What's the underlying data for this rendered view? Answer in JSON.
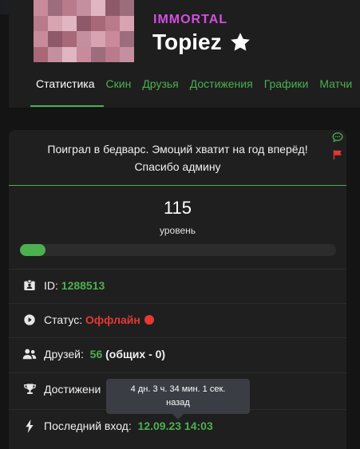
{
  "profile": {
    "rank": "IMMORTAL",
    "nickname": "Topiez",
    "rank_color": "#d34fe0"
  },
  "tabs": [
    {
      "label": "Статистика",
      "active": true
    },
    {
      "label": "Скин"
    },
    {
      "label": "Друзья"
    },
    {
      "label": "Достижения"
    },
    {
      "label": "Графики"
    },
    {
      "label": "Матчи"
    }
  ],
  "card": {
    "status_message": "Поиграл в бедварс. Эмоций хватит на год вперёд! Спасибо админу",
    "icons": [
      "comment-icon",
      "flag-icon"
    ],
    "level": {
      "value": "115",
      "label": "уровень",
      "progress": 0.08
    },
    "rows": {
      "id": {
        "label": "ID:",
        "value": "1288513"
      },
      "status": {
        "label": "Статус:",
        "value": "Оффлайн"
      },
      "friends": {
        "label": "Друзей:",
        "value": "56",
        "extra": "(общих - 0)"
      },
      "achievements": {
        "label": "Достижени"
      },
      "last_login": {
        "label": "Последний вход:",
        "value": "12.09.23 14:03"
      }
    }
  },
  "tooltip": {
    "line1": "4 дн. 3 ч. 34 мин. 1 сек.",
    "line2": "назад"
  },
  "colors": {
    "accent": "#4caf50",
    "offline": "#e53935",
    "background": "#141414",
    "card": "#1f1f1f"
  }
}
